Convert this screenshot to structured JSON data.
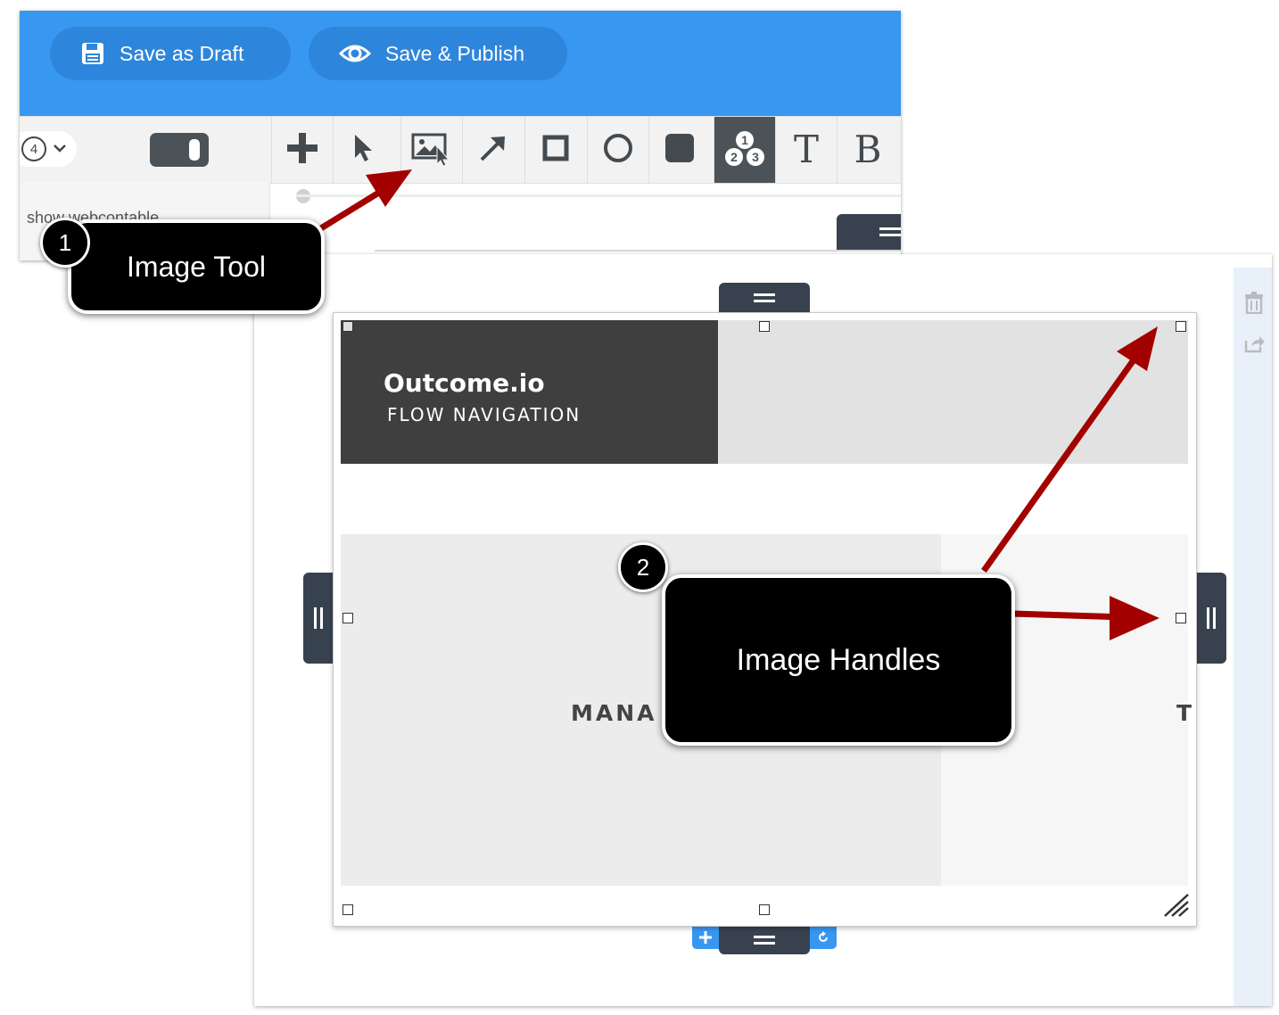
{
  "header": {
    "save_draft_label": "Save as Draft",
    "save_publish_label": "Save & Publish",
    "bg_color": "#3897f0"
  },
  "toolbar": {
    "page_selector": "4",
    "tools": [
      {
        "name": "add-tool",
        "icon": "plus-icon"
      },
      {
        "name": "select-tool",
        "icon": "cursor-icon"
      },
      {
        "name": "image-tool",
        "icon": "image-icon"
      },
      {
        "name": "arrow-tool",
        "icon": "arrow-icon"
      },
      {
        "name": "rectangle-tool",
        "icon": "square-icon"
      },
      {
        "name": "circle-tool",
        "icon": "circle-icon"
      },
      {
        "name": "filled-rect-tool",
        "icon": "filled-square-icon"
      },
      {
        "name": "numbered-steps-tool",
        "icon": "numbers-icon",
        "active": true
      },
      {
        "name": "text-tool",
        "icon": "text-icon",
        "label": "T"
      },
      {
        "name": "bold-tool",
        "icon": "bold-icon",
        "label": "B"
      }
    ],
    "numbers": [
      "1",
      "2",
      "3"
    ]
  },
  "panel": {
    "truncated_text": "show webcontable"
  },
  "image": {
    "brand_title": "Outcome.io",
    "brand_subtitle": "FLOW NAVIGATION",
    "partial_heading": "MANA",
    "partial_letter": "T"
  },
  "callouts": [
    {
      "number": "1",
      "label": "Image Tool"
    },
    {
      "number": "2",
      "label": "Image Handles"
    }
  ],
  "colors": {
    "accent_arrow": "#c00000",
    "handle_tab": "#38424f",
    "side_button": "#3897f0"
  }
}
